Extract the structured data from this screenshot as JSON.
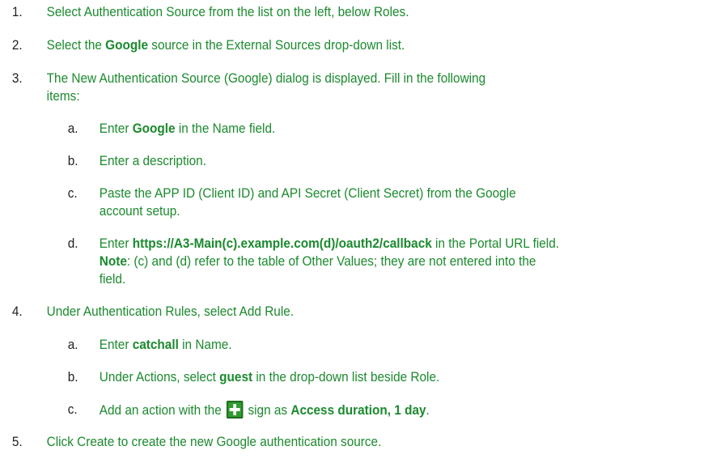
{
  "steps": [
    {
      "num": "1.",
      "parts": [
        {
          "t": "Select Authentication Source from the list on the left, below Roles.",
          "b": false
        }
      ]
    },
    {
      "num": "2.",
      "parts": [
        {
          "t": "Select the ",
          "b": false
        },
        {
          "t": "Google",
          "b": true
        },
        {
          "t": " source in the External Sources drop-down list.",
          "b": false
        }
      ]
    },
    {
      "num": "3.",
      "line1": "The New Authentication Source (Google) dialog is displayed. Fill in the following",
      "line2": "items:"
    },
    {
      "num": "4.",
      "parts": [
        {
          "t": "Under Authentication Rules, select Add Rule.",
          "b": false
        }
      ]
    },
    {
      "num": "5.",
      "parts": [
        {
          "t": "Click Create to create the new Google authentication source.",
          "b": false
        }
      ]
    }
  ],
  "step3_sub": [
    {
      "letter": "a.",
      "pre": "Enter ",
      "bold": "Google",
      "post": " in the Name field."
    },
    {
      "letter": "b.",
      "text": "Enter a description."
    },
    {
      "letter": "c.",
      "line1": "Paste the APP ID (Client ID) and API Secret (Client Secret) from the Google",
      "line2": "account setup."
    },
    {
      "letter": "d.",
      "pre": "Enter ",
      "bold": "https://A3-Main(c).example.com(d)/oauth2/callback",
      "post": " in the Portal URL field.",
      "note_label": "Note",
      "note_text": ": (c) and (d) refer to the table of Other Values; they are not entered into the",
      "line3": "field."
    }
  ],
  "step4_sub": [
    {
      "letter": "a.",
      "pre": "Enter ",
      "bold": "catchall",
      "post": " in Name."
    },
    {
      "letter": "b.",
      "pre": "Under Actions, select ",
      "bold": "guest",
      "post": " in the drop-down list beside Role."
    },
    {
      "letter": "c.",
      "pre": "Add an action with the ",
      "icon": "plus-icon",
      "mid": " sign as ",
      "bold": "Access duration, 1 day",
      "post": "."
    }
  ]
}
